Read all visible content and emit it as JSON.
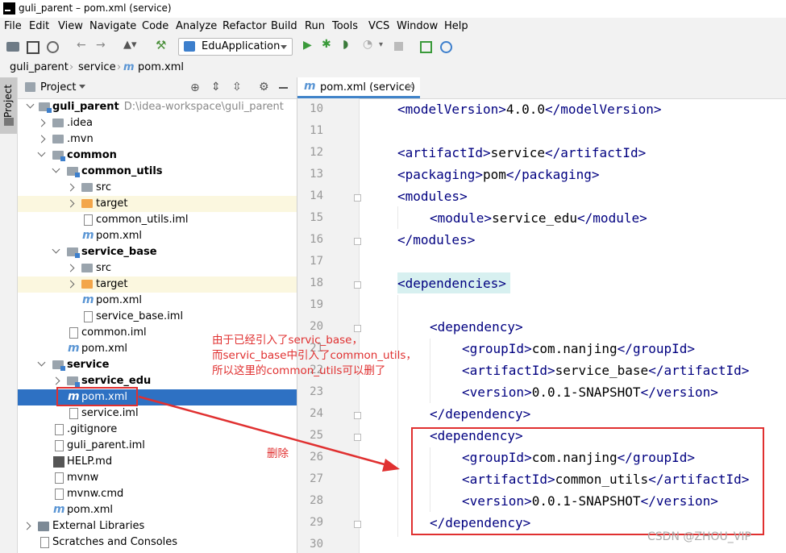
{
  "window": {
    "title": "guli_parent – pom.xml (service)"
  },
  "menu": [
    "File",
    "Edit",
    "View",
    "Navigate",
    "Code",
    "Analyze",
    "Refactor",
    "Build",
    "Run",
    "Tools",
    "VCS",
    "Window",
    "Help"
  ],
  "toolbar": {
    "run_config": "EduApplication"
  },
  "breadcrumb": [
    "guli_parent",
    "service",
    "pom.xml"
  ],
  "side_stripe": {
    "project_tab": "Project"
  },
  "project": {
    "header": "Project",
    "tree": [
      {
        "label": "guli_parent",
        "path": "D:\\idea-workspace\\guli_parent"
      },
      {
        "label": ".idea"
      },
      {
        "label": ".mvn"
      },
      {
        "label": "common"
      },
      {
        "label": "common_utils"
      },
      {
        "label": "src"
      },
      {
        "label": "target"
      },
      {
        "label": "common_utils.iml"
      },
      {
        "label": "pom.xml"
      },
      {
        "label": "service_base"
      },
      {
        "label": "src"
      },
      {
        "label": "target"
      },
      {
        "label": "pom.xml"
      },
      {
        "label": "service_base.iml"
      },
      {
        "label": "common.iml"
      },
      {
        "label": "pom.xml"
      },
      {
        "label": "service"
      },
      {
        "label": "service_edu"
      },
      {
        "label": "pom.xml"
      },
      {
        "label": "service.iml"
      },
      {
        "label": ".gitignore"
      },
      {
        "label": "guli_parent.iml"
      },
      {
        "label": "HELP.md"
      },
      {
        "label": "mvnw"
      },
      {
        "label": "mvnw.cmd"
      },
      {
        "label": "pom.xml"
      },
      {
        "label": "External Libraries"
      },
      {
        "label": "Scratches and Consoles"
      }
    ]
  },
  "editor": {
    "tab": "pom.xml (service)",
    "line_numbers": [
      "10",
      "11",
      "12",
      "13",
      "14",
      "15",
      "16",
      "17",
      "18",
      "19",
      "20",
      "21",
      "22",
      "23",
      "24",
      "25",
      "26",
      "27",
      "28",
      "29",
      "30"
    ],
    "code": [
      {
        "open": "<modelVersion>",
        "text": "4.0.0",
        "close": "</modelVersion>"
      },
      {
        "open": "<artifactId>",
        "text": "service",
        "close": "</artifactId>"
      },
      {
        "open": "<packaging>",
        "text": "pom",
        "close": "</packaging>"
      },
      {
        "open": "<modules>",
        "text": "",
        "close": ""
      },
      {
        "open": "<module>",
        "text": "service_edu",
        "close": "</module>"
      },
      {
        "open": "</modules>",
        "text": "",
        "close": ""
      },
      {
        "open": "<dependencies>",
        "text": "",
        "close": ""
      },
      {
        "open": "<dependency>",
        "text": "",
        "close": ""
      },
      {
        "open": "<groupId>",
        "text": "com.nanjing",
        "close": "</groupId>"
      },
      {
        "open": "<artifactId>",
        "text": "service_base",
        "close": "</artifactId>"
      },
      {
        "open": "<version>",
        "text": "0.0.1-SNAPSHOT",
        "close": "</version>"
      },
      {
        "open": "</dependency>",
        "text": "",
        "close": ""
      },
      {
        "open": "<dependency>",
        "text": "",
        "close": ""
      },
      {
        "open": "<groupId>",
        "text": "com.nanjing",
        "close": "</groupId>"
      },
      {
        "open": "<artifactId>",
        "text": "common_utils",
        "close": "</artifactId>"
      },
      {
        "open": "<version>",
        "text": "0.0.1-SNAPSHOT",
        "close": "</version>"
      },
      {
        "open": "</dependency>",
        "text": "",
        "close": ""
      }
    ]
  },
  "annotations": {
    "note": [
      "由于已经引入了servic_base，",
      "而servic_base中引入了common_utils，",
      "所以这里的common_utils可以删了"
    ],
    "delete_label": "删除",
    "annotation_color": "#e03030"
  },
  "watermark": "CSDN @ZHOU_VIP",
  "colors": {
    "selection": "#2e71c3",
    "tag": "#000080",
    "highlight": "#d7f0f0",
    "excluded_folder": "#fbf7df"
  }
}
